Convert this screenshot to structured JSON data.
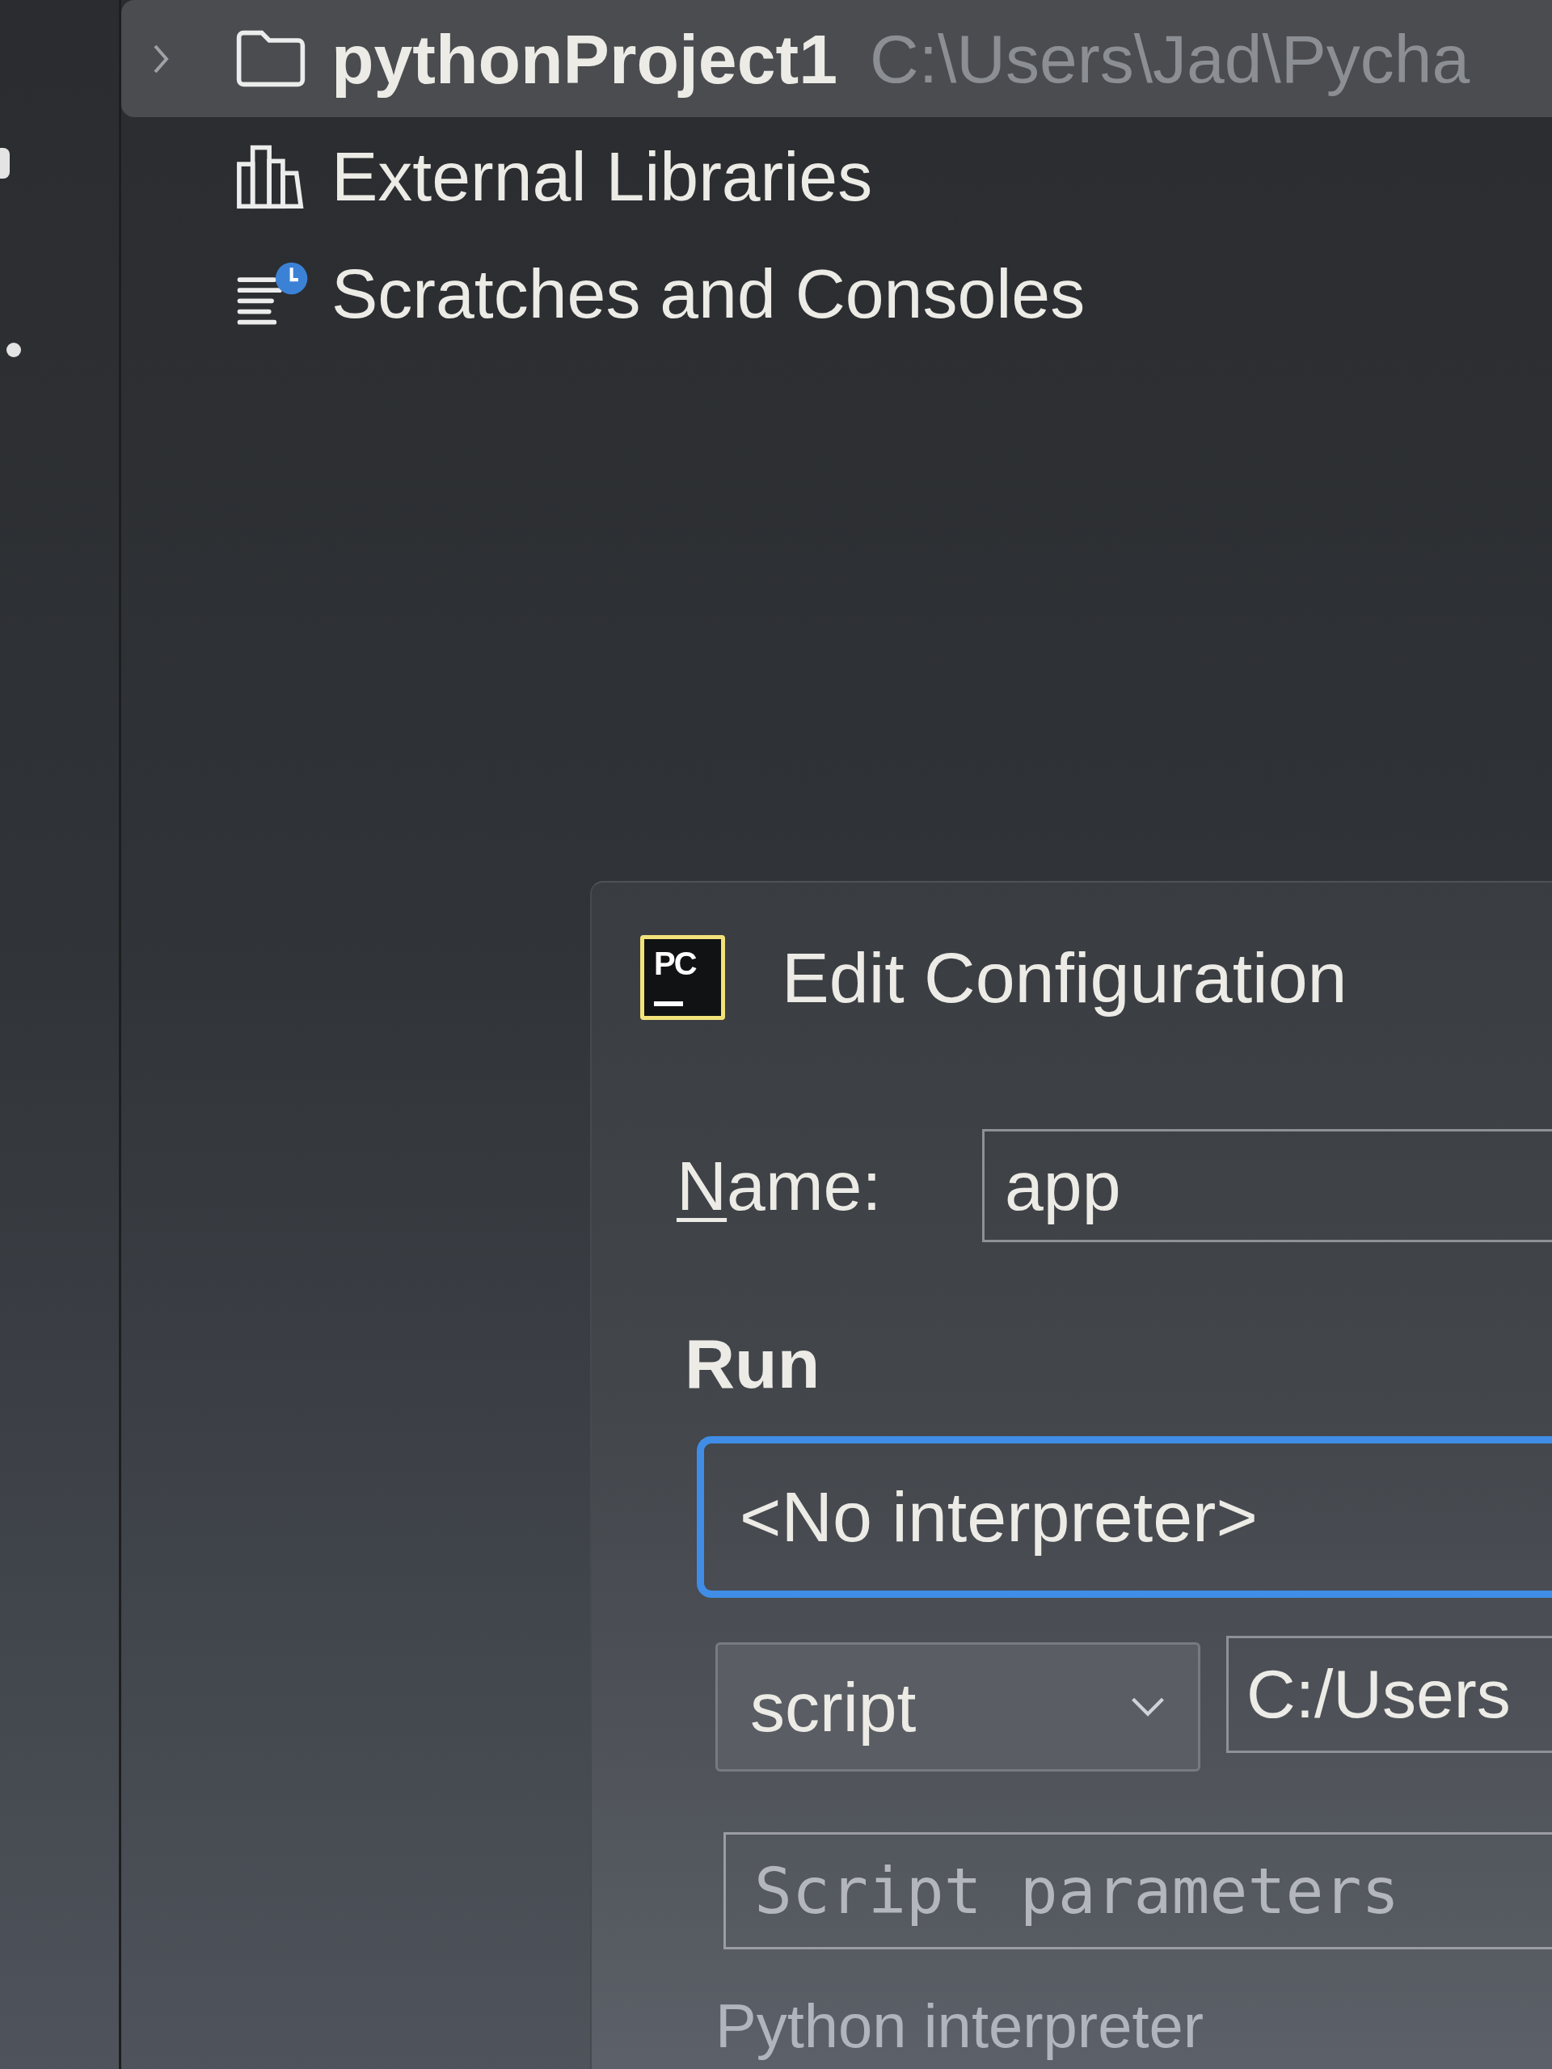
{
  "project_tree": {
    "items": [
      {
        "kind": "folder",
        "label": "pythonProject1",
        "path": "C:\\Users\\Jad\\Pycha",
        "expanded": false,
        "selected": true
      },
      {
        "kind": "libraries",
        "label": "External Libraries",
        "selected": false
      },
      {
        "kind": "scratches",
        "label": "Scratches and Consoles",
        "selected": false
      }
    ]
  },
  "dialog": {
    "logo_text": "PC",
    "title": "Edit Configuration",
    "name_field": {
      "label": "Name:",
      "mnemonic_underlined": true,
      "value": "app"
    },
    "run_section": {
      "heading": "Run",
      "interpreter_dropdown": {
        "value": "<No interpreter>",
        "focused": true
      },
      "target_type_dropdown": {
        "value": "script"
      },
      "script_path_field": {
        "value": "C:/Users"
      },
      "parameters_field": {
        "placeholder": "Script parameters"
      },
      "interpreter_label": "Python interpreter"
    }
  }
}
